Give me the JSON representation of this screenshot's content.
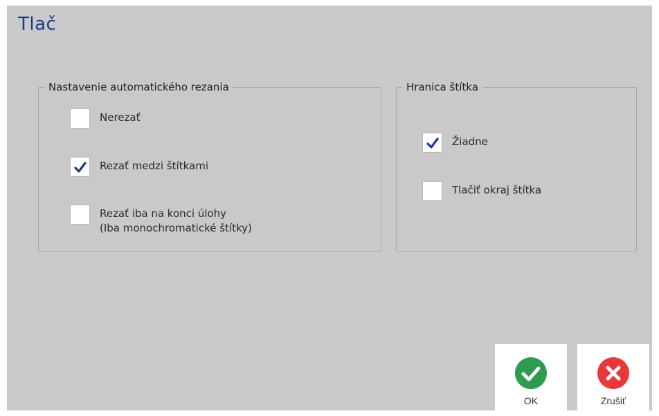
{
  "dialog": {
    "title": "Tlač"
  },
  "cut_group": {
    "legend": "Nastavenie automatického rezania",
    "options": [
      {
        "label": "Nerezať",
        "checked": false
      },
      {
        "label": "Rezať medzi štítkami",
        "checked": true
      },
      {
        "label_line1": "Rezať iba na konci úlohy",
        "label_line2": "(Iba monochromatické štítky)",
        "checked": false
      }
    ]
  },
  "border_group": {
    "legend": "Hranica štítka",
    "options": [
      {
        "label": "Žiadne",
        "checked": true
      },
      {
        "label": "Tlačiť okraj štítka",
        "checked": false
      }
    ]
  },
  "buttons": {
    "ok": {
      "label": "OK",
      "icon": "check-circle-icon",
      "color": "#2e9b4e"
    },
    "cancel": {
      "label": "Zrušiť",
      "icon": "x-circle-icon",
      "color": "#e8393a"
    }
  },
  "colors": {
    "title": "#1b3a86",
    "checkmark": "#1b3a86",
    "background": "#c9c9c9"
  }
}
